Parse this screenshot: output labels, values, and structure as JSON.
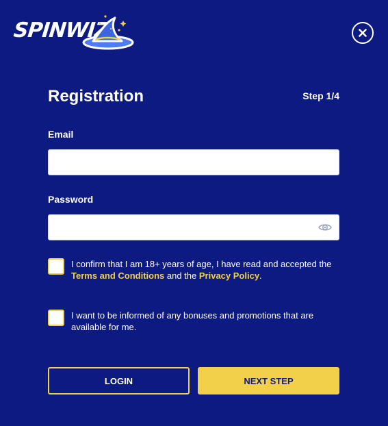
{
  "brand": {
    "logo_text": "SPINWIZ",
    "logo_icon": "wizard-hat-icon",
    "colors": {
      "background": "#0d1a82",
      "accent": "#f2d04a",
      "text": "#ffffff"
    }
  },
  "header": {
    "close_icon": "close-icon"
  },
  "form": {
    "title": "Registration",
    "step": "Step 1/4",
    "email_label": "Email",
    "email_value": "",
    "password_label": "Password",
    "password_value": "",
    "password_toggle_icon": "eye-icon",
    "age_confirm": {
      "checked": false,
      "text_before": "I confirm that I am 18+ years of age, I have read and accepted the ",
      "terms_link": "Terms and Conditions",
      "text_middle": " and the ",
      "privacy_link": "Privacy Policy",
      "text_after": "."
    },
    "marketing_optin": {
      "checked": false,
      "text": "I want to be informed of any bonuses and promotions that are available for me."
    },
    "login_button": "LOGIN",
    "next_button": "NEXT STEP"
  }
}
